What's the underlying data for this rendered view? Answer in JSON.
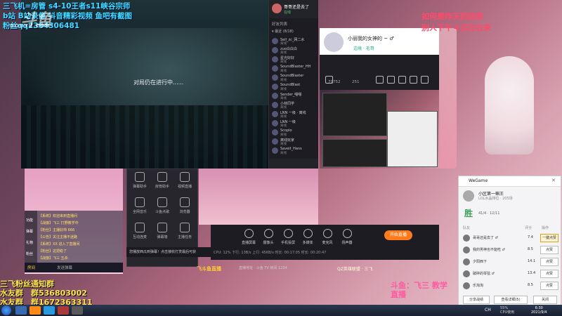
{
  "overlay": {
    "left_lines": [
      "三飞机=房管 s4-10王者s11峡谷宗师",
      "b站 B站录像 抖音精彩视频 鱼吧有截图",
      "粉丝qq2364306481"
    ],
    "logo": "斗鱼",
    "logo_sub": "DOUYU.COM",
    "right_lines": [
      "如何是昨天的回房",
      "别人下午４点左右来"
    ],
    "bottom_left_lines": [
      "三飞粉丝通知群",
      "水友群　群536803002",
      "水友群　群1672363311"
    ],
    "bottom_right_lines": [
      "斗鱼：飞三 教学",
      "直播"
    ]
  },
  "game": {
    "status_text": "对局仍在进行中......"
  },
  "chat": {
    "name": "哥哥还是去了",
    "status": "在线",
    "tab": "好友列表",
    "group": "▾ 最近 (8/18)",
    "items": [
      {
        "name": "Sell_zc_网二水",
        "tag": "离线"
      },
      {
        "name": "zuo白白白",
        "tag": "离线"
      },
      {
        "name": "星光好好",
        "tag": "离线"
      },
      {
        "name": "SoundBlaster_HH",
        "tag": "离线"
      },
      {
        "name": "SoundBlaster",
        "tag": "离线"
      },
      {
        "name": "SoundBlast",
        "tag": "离线"
      },
      {
        "name": "Sender_喵喵",
        "tag": "离线"
      },
      {
        "name": "小林同学",
        "tag": "离线"
      },
      {
        "name": "LNN 一级 · 离线",
        "tag": "离线"
      },
      {
        "name": "LNN 一级",
        "tag": "离线"
      },
      {
        "name": "Scopio",
        "tag": "离线"
      },
      {
        "name": "离线玩家",
        "tag": "离线"
      },
      {
        "name": "Saveit_Hans",
        "tag": "离线"
      }
    ]
  },
  "profile": {
    "name": "小丽我的女神的 ~ ♂",
    "team": "边境 · 毛哥"
  },
  "tool": {
    "stat_fans": "79752",
    "stat_likes": "251"
  },
  "menu": {
    "items": [
      "弹幕助手",
      "房管助手",
      "视频直播",
      "全网音乐",
      "斗鱼点歌",
      "浏览器",
      "互动连麦",
      "弹幕墙",
      "主播任务",
      "录屏",
      "斗鱼相册",
      "画板"
    ],
    "tip": "您播放西瓜到弹幕！点击接收打赏最后可获"
  },
  "broadcaster": {
    "items": [
      "直播屏幕",
      "摄像头",
      "手机投屏",
      "多媒体",
      "麦克风",
      "扬声器"
    ],
    "start_label": "开始直播",
    "stats": "CPU: 12%    下行: 13B/s    上行: 45KB/s    时长: 00:17:05    时长: 00:20:47"
  },
  "left_preview": {
    "side_items": [
      "功能",
      "弹幕",
      "礼物",
      "粉丝"
    ],
    "lines": [
      "【系统】欢迎来到直播间",
      "【战旗】飞三 打野教学中",
      "【粉丝】主播好帅 666",
      "【公告】关注主播不迷路",
      "【系统】XX 进入了直播间",
      "【粉丝】这把稳了",
      "【战旗】飞三 五杀"
    ],
    "bar_left": "房间",
    "bar_right": "发送弹幕"
  },
  "center": {
    "sf_logo": "飞斗鱼直播",
    "addr": "直播地址 · 斗鱼 TV 房间 1234",
    "room": "QZ英雄联盟 · 三飞"
  },
  "wegame": {
    "title": "WeGame",
    "close": "✕",
    "player_name": "小区第一蝌王",
    "player_desc": "LOL水晶排位 · 205场",
    "result": "胜",
    "kda": "41/4 · 12/11",
    "col_team": "队友",
    "col_score": "评分",
    "col_action": "操作",
    "rows": [
      {
        "name": "哥哥还是去了 ♂",
        "score": "7.4",
        "btn": "一键点赞",
        "hl": true
      },
      {
        "name": "我的男神也不能吃 ♂",
        "score": "8.5",
        "btn": "点赞",
        "hl": false
      },
      {
        "name": "夕阳西下",
        "score": "14.1",
        "btn": "点赞",
        "hl": false
      },
      {
        "name": "破碎的琴弦 ♂",
        "score": "13.4",
        "btn": "点赞",
        "hl": false
      },
      {
        "name": "乐淘淘",
        "score": "8.5",
        "btn": "点赞",
        "hl": false
      }
    ],
    "btn_left": "分享战绩",
    "btn_mid": "查看详细(5)",
    "btn_right": "关闭"
  },
  "taskbar": {
    "lang": "CH",
    "cpu_line1": "55%",
    "cpu_line2": "CPU使用",
    "time": "6:30",
    "date": "2021/9/4"
  }
}
